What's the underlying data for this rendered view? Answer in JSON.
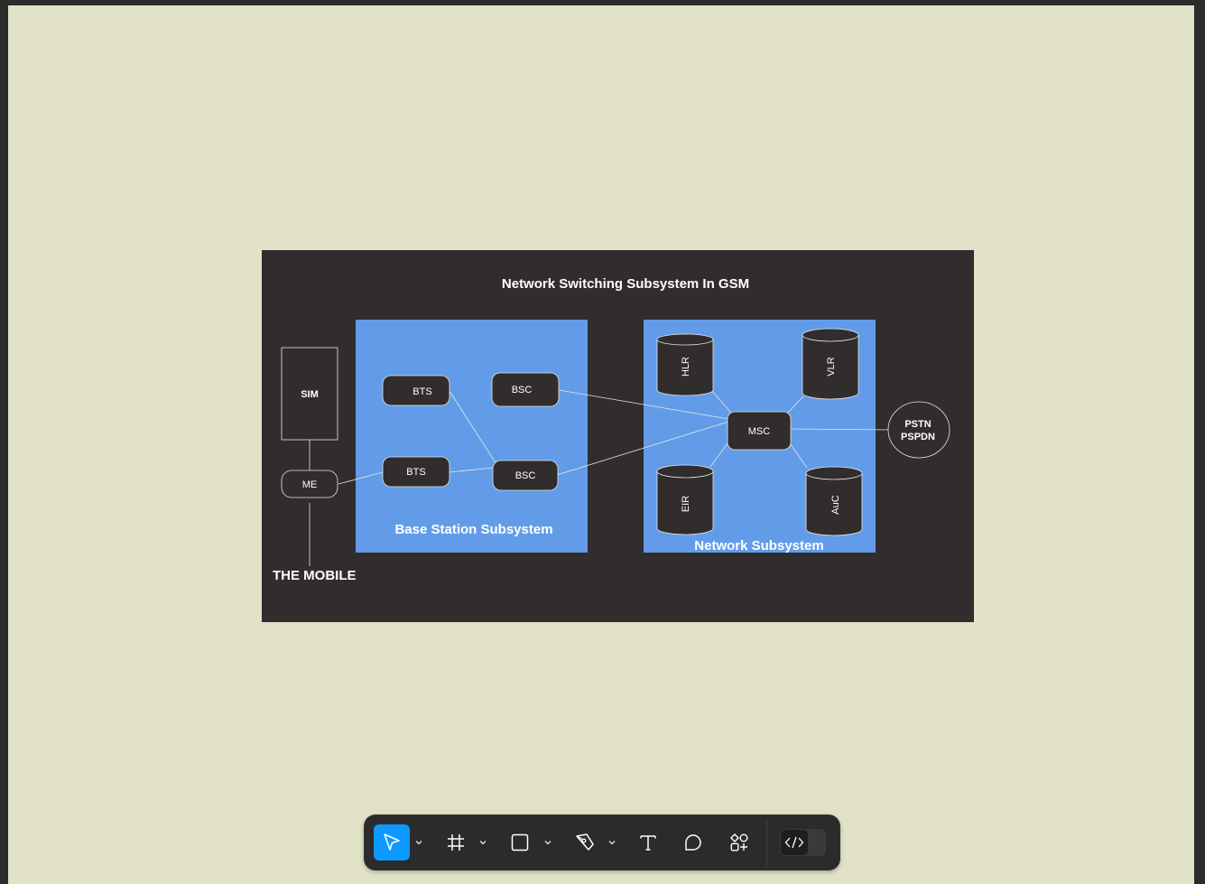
{
  "diagram": {
    "title": "Network Switching Subsystem In GSM",
    "bss_label": "Base Station Subsystem",
    "nss_label": "Network Subsystem",
    "mobile_label": "THE MOBILE",
    "sim": "SIM",
    "me": "ME",
    "bts_top": "BTS",
    "bts_bottom": "BTS",
    "bsc_top": "BSC",
    "bsc_bottom": "BSC",
    "msc": "MSC",
    "hlr": "HLR",
    "vlr": "VLR",
    "eir": "EIR",
    "auc": "AuC",
    "pstn_line1": "PSTN",
    "pstn_line2": "PSPDN"
  },
  "colors": {
    "canvas": "#e1e2c8",
    "frame": "#312d2d",
    "subsystem_fill": "#629ce8",
    "node_fill": "#312d2d",
    "toolbar": "#2b2b2b",
    "accent": "#0d99ff"
  },
  "toolbar": {
    "tools": [
      {
        "name": "move-tool",
        "icon": "cursor-arrow-icon",
        "active": true
      },
      {
        "name": "frame-tool",
        "icon": "hash-frame-icon",
        "active": false
      },
      {
        "name": "rectangle-tool",
        "icon": "square-icon",
        "active": false
      },
      {
        "name": "pen-tool",
        "icon": "pen-nib-icon",
        "active": false
      },
      {
        "name": "text-tool",
        "icon": "text-t-icon",
        "active": false
      },
      {
        "name": "comment-tool",
        "icon": "speech-bubble-icon",
        "active": false
      },
      {
        "name": "assets-tool",
        "icon": "shapes-plus-icon",
        "active": false
      }
    ],
    "dev_mode": {
      "icon": "code-brackets-icon",
      "enabled": false
    }
  }
}
